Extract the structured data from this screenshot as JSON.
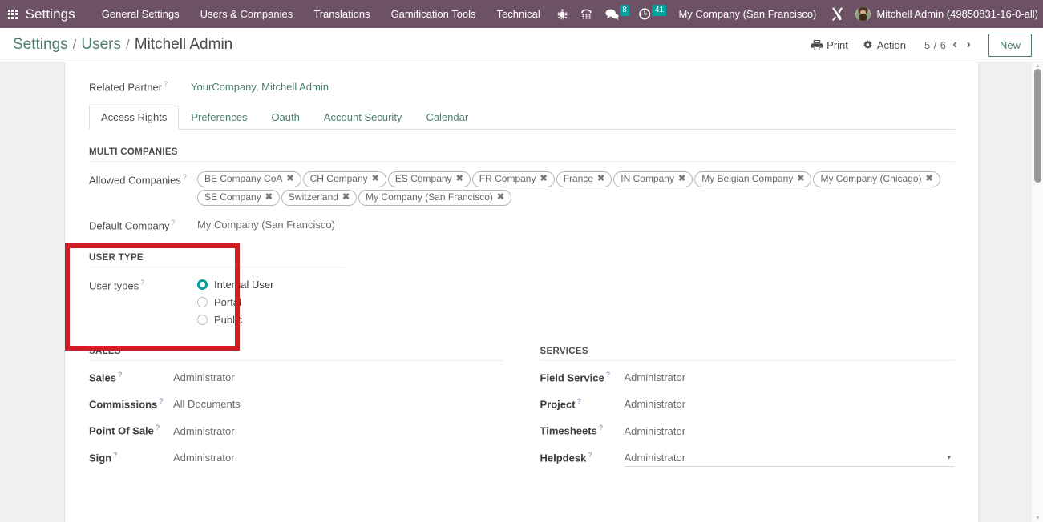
{
  "navbar": {
    "apps_icon": "grid-apps-icon",
    "brand": "Settings",
    "menus": [
      {
        "label": "General Settings"
      },
      {
        "label": "Users & Companies"
      },
      {
        "label": "Translations"
      },
      {
        "label": "Gamification Tools"
      },
      {
        "label": "Technical"
      }
    ],
    "icons": [
      {
        "name": "bug-debug-icon"
      },
      {
        "name": "phone-dialpad-icon"
      }
    ],
    "counters": [
      {
        "name": "messages-icon",
        "badge": "8"
      },
      {
        "name": "activities-clock-icon",
        "badge": "41"
      }
    ],
    "company_switcher": "My Company (San Francisco)",
    "tools_icon": "tools-cross-icon",
    "user_name": "Mitchell Admin (49850831-16-0-all)",
    "avatar": "user-avatar",
    "background_color": "#6d5265",
    "badge_color": "#00a09d"
  },
  "control_panel": {
    "breadcrumb": {
      "root": "Settings",
      "separator": "/",
      "parent": "Users",
      "current": "Mitchell Admin"
    },
    "print_label": "Print",
    "print_icon": "printer-icon",
    "action_label": "Action",
    "action_icon": "gear-icon",
    "pager": "5 / 6",
    "prev_icon": "‹",
    "next_icon": "›",
    "new_label": "New",
    "accent_color": "#4f7d74"
  },
  "form": {
    "related_partner": {
      "label": "Related Partner",
      "help": "?",
      "value": "YourCompany, Mitchell Admin"
    },
    "tabs": [
      {
        "label": "Access Rights",
        "active": true
      },
      {
        "label": "Preferences",
        "active": false
      },
      {
        "label": "Oauth",
        "active": false
      },
      {
        "label": "Account Security",
        "active": false
      },
      {
        "label": "Calendar",
        "active": false
      }
    ],
    "multi_companies": {
      "title": "MULTI COMPANIES",
      "allowed_companies_label": "Allowed Companies",
      "allowed_companies": [
        "BE Company CoA",
        "CH Company",
        "ES Company",
        "FR Company",
        "France",
        "IN Company",
        "My Belgian Company",
        "My Company (Chicago)",
        "SE Company",
        "Switzerland",
        "My Company (San Francisco)"
      ],
      "tag_remove_icon": "✖",
      "default_company_label": "Default Company",
      "default_company_value": "My Company (San Francisco)"
    },
    "user_type": {
      "title": "USER TYPE",
      "field_label": "User types",
      "options": [
        {
          "label": "Internal User",
          "checked": true
        },
        {
          "label": "Portal",
          "checked": false
        },
        {
          "label": "Public",
          "checked": false
        }
      ],
      "highlight_color": "#cc2026",
      "radio_color": "#00a09d"
    },
    "sales": {
      "title": "SALES",
      "rows": [
        {
          "label": "Sales",
          "value": "Administrator"
        },
        {
          "label": "Commissions",
          "value": "All Documents"
        },
        {
          "label": "Point Of Sale",
          "value": "Administrator"
        },
        {
          "label": "Sign",
          "value": "Administrator"
        }
      ]
    },
    "services": {
      "title": "SERVICES",
      "rows": [
        {
          "label": "Field Service",
          "value": "Administrator",
          "open": false
        },
        {
          "label": "Project",
          "value": "Administrator",
          "open": false
        },
        {
          "label": "Timesheets",
          "value": "Administrator",
          "open": false
        },
        {
          "label": "Helpdesk",
          "value": "Administrator",
          "open": true
        }
      ],
      "caret_icon": "▾"
    },
    "help_marker": "?"
  }
}
